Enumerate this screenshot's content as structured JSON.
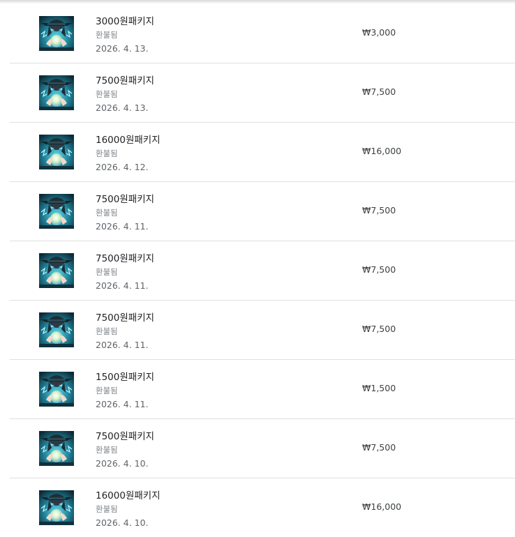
{
  "purchases": [
    {
      "title": "3000원패키지",
      "status": "환불됨",
      "date": "2026. 4. 13.",
      "price": "₩3,000",
      "icon": "app-icon-wizard"
    },
    {
      "title": "7500원패키지",
      "status": "환불됨",
      "date": "2026. 4. 13.",
      "price": "₩7,500",
      "icon": "app-icon-wizard"
    },
    {
      "title": "16000원패키지",
      "status": "환불됨",
      "date": "2026. 4. 12.",
      "price": "₩16,000",
      "icon": "app-icon-wizard"
    },
    {
      "title": "7500원패키지",
      "status": "환불됨",
      "date": "2026. 4. 11.",
      "price": "₩7,500",
      "icon": "app-icon-wizard"
    },
    {
      "title": "7500원패키지",
      "status": "환불됨",
      "date": "2026. 4. 11.",
      "price": "₩7,500",
      "icon": "app-icon-wizard"
    },
    {
      "title": "7500원패키지",
      "status": "환불됨",
      "date": "2026. 4. 11.",
      "price": "₩7,500",
      "icon": "app-icon-wizard"
    },
    {
      "title": "1500원패키지",
      "status": "환불됨",
      "date": "2026. 4. 11.",
      "price": "₩1,500",
      "icon": "app-icon-wizard"
    },
    {
      "title": "7500원패키지",
      "status": "환불됨",
      "date": "2026. 4. 10.",
      "price": "₩7,500",
      "icon": "app-icon-wizard"
    },
    {
      "title": "16000원패키지",
      "status": "환불됨",
      "date": "2026. 4. 10.",
      "price": "₩16,000",
      "icon": "app-icon-wizard"
    }
  ]
}
